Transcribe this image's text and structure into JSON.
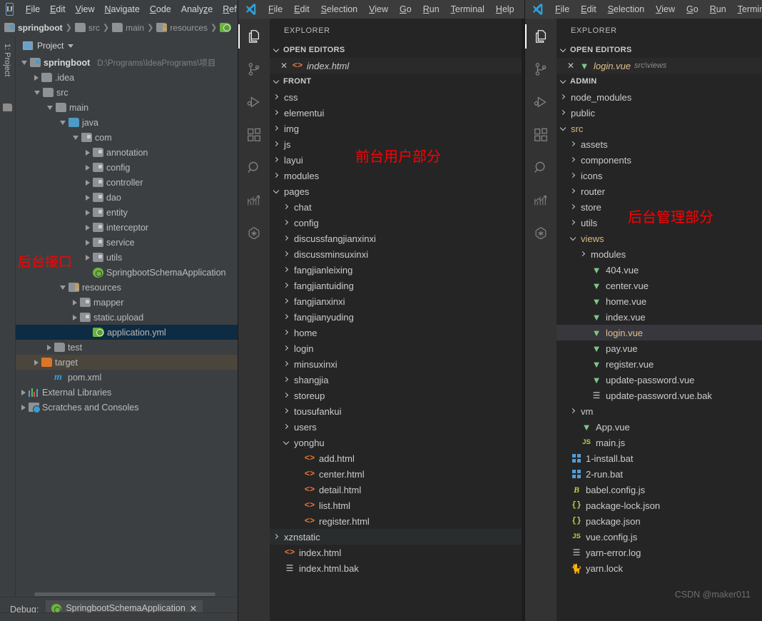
{
  "idea": {
    "logo": "IJ",
    "menu": [
      "File",
      "Edit",
      "View",
      "Navigate",
      "Code",
      "Analyze",
      "Ref"
    ],
    "breadcrumb": [
      "springboot",
      "src",
      "main",
      "resources"
    ],
    "tool_window": "1: Project",
    "panel_title": "Project",
    "tree": [
      {
        "label": "springboot",
        "path": "D:\\Programs\\IdeaPrograms\\项目",
        "icon": "module-icon",
        "arrow": "down",
        "depth": 0,
        "bold": true
      },
      {
        "label": ".idea",
        "icon": "folder-icon",
        "arrow": "right",
        "depth": 1
      },
      {
        "label": "src",
        "icon": "folder-icon",
        "arrow": "down",
        "depth": 1
      },
      {
        "label": "main",
        "icon": "folder-icon",
        "arrow": "down",
        "depth": 2
      },
      {
        "label": "java",
        "icon": "source-root-icon",
        "arrow": "down",
        "depth": 3
      },
      {
        "label": "com",
        "icon": "package-icon",
        "arrow": "down",
        "depth": 4
      },
      {
        "label": "annotation",
        "icon": "package-icon",
        "arrow": "right",
        "depth": 5
      },
      {
        "label": "config",
        "icon": "package-icon",
        "arrow": "right",
        "depth": 5
      },
      {
        "label": "controller",
        "icon": "package-icon",
        "arrow": "right",
        "depth": 5
      },
      {
        "label": "dao",
        "icon": "package-icon",
        "arrow": "right",
        "depth": 5
      },
      {
        "label": "entity",
        "icon": "package-icon",
        "arrow": "right",
        "depth": 5
      },
      {
        "label": "interceptor",
        "icon": "package-icon",
        "arrow": "right",
        "depth": 5
      },
      {
        "label": "service",
        "icon": "package-icon",
        "arrow": "right",
        "depth": 5
      },
      {
        "label": "utils",
        "icon": "package-icon",
        "arrow": "right",
        "depth": 5
      },
      {
        "label": "SpringbootSchemaApplication",
        "icon": "spring-class-icon",
        "arrow": "none",
        "depth": 5
      },
      {
        "label": "resources",
        "icon": "resources-root-icon",
        "arrow": "down",
        "depth": 3
      },
      {
        "label": "mapper",
        "icon": "package-icon",
        "arrow": "right",
        "depth": 4
      },
      {
        "label": "static.upload",
        "icon": "package-icon",
        "arrow": "right",
        "depth": 4
      },
      {
        "label": "application.yml",
        "icon": "spring-yaml-icon",
        "arrow": "none",
        "depth": 5,
        "state": "selected"
      },
      {
        "label": "test",
        "icon": "folder-icon",
        "arrow": "right",
        "depth": 2
      },
      {
        "label": "target",
        "icon": "folder-excluded-icon",
        "arrow": "right",
        "depth": 1,
        "state": "target"
      },
      {
        "label": "pom.xml",
        "icon": "maven-icon",
        "arrow": "none",
        "depth": 2
      },
      {
        "label": "External Libraries",
        "icon": "library-icon",
        "arrow": "right",
        "depth": 0
      },
      {
        "label": "Scratches and Consoles",
        "icon": "scratch-icon",
        "arrow": "right",
        "depth": 0
      }
    ],
    "status": {
      "debug_label": "Debug:",
      "run_config": "SpringbootSchemaApplication"
    },
    "annotation": "后台接口"
  },
  "vscode_front": {
    "menu": [
      "File",
      "Edit",
      "Selection",
      "View",
      "Go",
      "Run",
      "Terminal",
      "Help"
    ],
    "explorer_title": "EXPLORER",
    "open_editors_label": "OPEN EDITORS",
    "open_editor": {
      "name": "index.html",
      "icon": "html-icon"
    },
    "project_label": "FRONT",
    "annotation": "前台用户部分",
    "tree": [
      {
        "label": "css",
        "type": "folder",
        "state": "collapsed",
        "depth": 1
      },
      {
        "label": "elementui",
        "type": "folder",
        "state": "collapsed",
        "depth": 1
      },
      {
        "label": "img",
        "type": "folder",
        "state": "collapsed",
        "depth": 1
      },
      {
        "label": "js",
        "type": "folder",
        "state": "collapsed",
        "depth": 1
      },
      {
        "label": "layui",
        "type": "folder",
        "state": "collapsed",
        "depth": 1
      },
      {
        "label": "modules",
        "type": "folder",
        "state": "collapsed",
        "depth": 1
      },
      {
        "label": "pages",
        "type": "folder",
        "state": "expanded",
        "depth": 1
      },
      {
        "label": "chat",
        "type": "folder",
        "state": "collapsed",
        "depth": 2
      },
      {
        "label": "config",
        "type": "folder",
        "state": "collapsed",
        "depth": 2
      },
      {
        "label": "discussfangjianxinxi",
        "type": "folder",
        "state": "collapsed",
        "depth": 2
      },
      {
        "label": "discussminsuxinxi",
        "type": "folder",
        "state": "collapsed",
        "depth": 2
      },
      {
        "label": "fangjianleixing",
        "type": "folder",
        "state": "collapsed",
        "depth": 2
      },
      {
        "label": "fangjiantuiding",
        "type": "folder",
        "state": "collapsed",
        "depth": 2
      },
      {
        "label": "fangjianxinxi",
        "type": "folder",
        "state": "collapsed",
        "depth": 2
      },
      {
        "label": "fangjianyuding",
        "type": "folder",
        "state": "collapsed",
        "depth": 2
      },
      {
        "label": "home",
        "type": "folder",
        "state": "collapsed",
        "depth": 2
      },
      {
        "label": "login",
        "type": "folder",
        "state": "collapsed",
        "depth": 2
      },
      {
        "label": "minsuxinxi",
        "type": "folder",
        "state": "collapsed",
        "depth": 2
      },
      {
        "label": "shangjia",
        "type": "folder",
        "state": "collapsed",
        "depth": 2
      },
      {
        "label": "storeup",
        "type": "folder",
        "state": "collapsed",
        "depth": 2
      },
      {
        "label": "tousufankui",
        "type": "folder",
        "state": "collapsed",
        "depth": 2
      },
      {
        "label": "users",
        "type": "folder",
        "state": "collapsed",
        "depth": 2
      },
      {
        "label": "yonghu",
        "type": "folder",
        "state": "expanded",
        "depth": 2
      },
      {
        "label": "add.html",
        "type": "file",
        "icon": "html-icon",
        "depth": 3
      },
      {
        "label": "center.html",
        "type": "file",
        "icon": "html-icon",
        "depth": 3
      },
      {
        "label": "detail.html",
        "type": "file",
        "icon": "html-icon",
        "depth": 3
      },
      {
        "label": "list.html",
        "type": "file",
        "icon": "html-icon",
        "depth": 3
      },
      {
        "label": "register.html",
        "type": "file",
        "icon": "html-icon",
        "depth": 3
      },
      {
        "label": "xznstatic",
        "type": "folder",
        "state": "collapsed",
        "depth": 1,
        "row_state": "hover"
      },
      {
        "label": "index.html",
        "type": "file",
        "icon": "html-icon",
        "depth": 1
      },
      {
        "label": "index.html.bak",
        "type": "file",
        "icon": "log-icon",
        "depth": 1
      }
    ]
  },
  "vscode_admin": {
    "menu": [
      "File",
      "Edit",
      "Selection",
      "View",
      "Go",
      "Run",
      "Termin"
    ],
    "explorer_title": "EXPLORER",
    "open_editors_label": "OPEN EDITORS",
    "open_editor": {
      "name": "login.vue",
      "path": "src\\views",
      "icon": "vue-icon"
    },
    "project_label": "ADMIN",
    "annotation": "后台管理部分",
    "watermark": "CSDN @maker011",
    "tree": [
      {
        "label": "node_modules",
        "type": "folder",
        "state": "collapsed",
        "depth": 1
      },
      {
        "label": "public",
        "type": "folder",
        "state": "collapsed",
        "depth": 1
      },
      {
        "label": "src",
        "type": "folder",
        "state": "expanded",
        "depth": 1,
        "color": "amber"
      },
      {
        "label": "assets",
        "type": "folder",
        "state": "collapsed",
        "depth": 2
      },
      {
        "label": "components",
        "type": "folder",
        "state": "collapsed",
        "depth": 2
      },
      {
        "label": "icons",
        "type": "folder",
        "state": "collapsed",
        "depth": 2
      },
      {
        "label": "router",
        "type": "folder",
        "state": "collapsed",
        "depth": 2
      },
      {
        "label": "store",
        "type": "folder",
        "state": "collapsed",
        "depth": 2
      },
      {
        "label": "utils",
        "type": "folder",
        "state": "collapsed",
        "depth": 2
      },
      {
        "label": "views",
        "type": "folder",
        "state": "expanded",
        "depth": 2,
        "color": "amber"
      },
      {
        "label": "modules",
        "type": "folder",
        "state": "collapsed",
        "depth": 3
      },
      {
        "label": "404.vue",
        "type": "file",
        "icon": "vue-icon",
        "depth": 3
      },
      {
        "label": "center.vue",
        "type": "file",
        "icon": "vue-icon",
        "depth": 3
      },
      {
        "label": "home.vue",
        "type": "file",
        "icon": "vue-icon",
        "depth": 3
      },
      {
        "label": "index.vue",
        "type": "file",
        "icon": "vue-icon",
        "depth": 3
      },
      {
        "label": "login.vue",
        "type": "file",
        "icon": "vue-icon",
        "depth": 3,
        "row_state": "selected",
        "color": "sel-amber"
      },
      {
        "label": "pay.vue",
        "type": "file",
        "icon": "vue-icon",
        "depth": 3
      },
      {
        "label": "register.vue",
        "type": "file",
        "icon": "vue-icon",
        "depth": 3
      },
      {
        "label": "update-password.vue",
        "type": "file",
        "icon": "vue-icon",
        "depth": 3
      },
      {
        "label": "update-password.vue.bak",
        "type": "file",
        "icon": "log-icon",
        "depth": 3
      },
      {
        "label": "vm",
        "type": "folder",
        "state": "collapsed",
        "depth": 2
      },
      {
        "label": "App.vue",
        "type": "file",
        "icon": "vue-icon",
        "depth": 2
      },
      {
        "label": "main.js",
        "type": "file",
        "icon": "js-icon",
        "depth": 2
      },
      {
        "label": "1-install.bat",
        "type": "file",
        "icon": "bat-icon",
        "depth": 1
      },
      {
        "label": "2-run.bat",
        "type": "file",
        "icon": "bat-icon",
        "depth": 1
      },
      {
        "label": "babel.config.js",
        "type": "file",
        "icon": "babel-icon",
        "depth": 1
      },
      {
        "label": "package-lock.json",
        "type": "file",
        "icon": "json-icon",
        "depth": 1
      },
      {
        "label": "package.json",
        "type": "file",
        "icon": "json-icon",
        "depth": 1
      },
      {
        "label": "vue.config.js",
        "type": "file",
        "icon": "js-icon",
        "depth": 1
      },
      {
        "label": "yarn-error.log",
        "type": "file",
        "icon": "log-icon",
        "depth": 1
      },
      {
        "label": "yarn.lock",
        "type": "file",
        "icon": "yarn-icon",
        "depth": 1
      }
    ]
  },
  "activity_bar_icons": [
    "explorer-icon",
    "source-control-icon",
    "run-debug-icon",
    "extensions-icon",
    "search-icon",
    "trend-chart-icon",
    "openai-icon"
  ],
  "colors": {
    "idea_bg": "#3c3f41",
    "idea_selection": "#0d2b42",
    "idea_target": "#4a463c",
    "vscode_bg": "#1e1e1e",
    "vscode_sidebar": "#252526",
    "vscode_selection": "#37373d",
    "annotation_red": "#ff0000",
    "html_orange": "#e37933",
    "vue_green": "#81c784",
    "js_yellow": "#cbcb41",
    "folder_amber": "#d7ba7d"
  }
}
